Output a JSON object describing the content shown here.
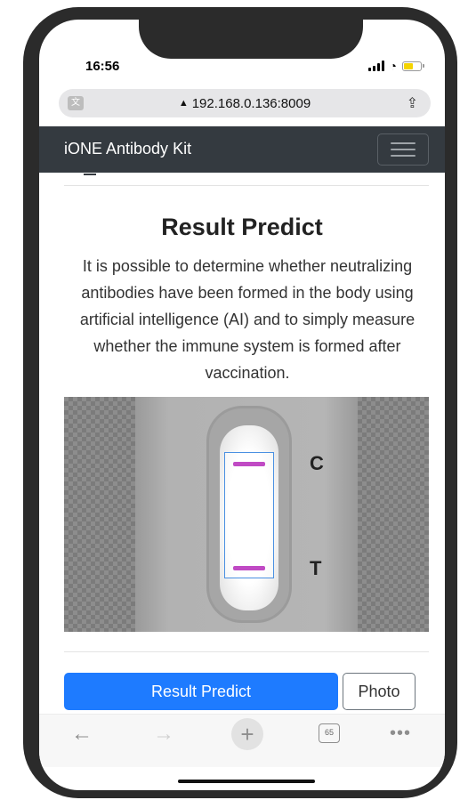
{
  "status_bar": {
    "time": "16:56"
  },
  "address_bar": {
    "url": "192.168.0.136:8009",
    "warning_glyph": "▲",
    "translate_glyph": "文"
  },
  "navbar": {
    "brand": "iONE Antibody Kit"
  },
  "content": {
    "title": "Result Predict",
    "description": "It is possible to determine whether neutralizing antibodies have been formed in the body using artificial intelligence (AI) and to simply measure whether the immune system is formed after vaccination."
  },
  "test_image": {
    "control_label": "C",
    "test_label": "T"
  },
  "actions": {
    "predict_label": "Result Predict",
    "photo_label": "Photo"
  },
  "toolbar": {
    "tab_count": "65"
  },
  "colors": {
    "navbar_bg": "#343a40",
    "primary_button": "#1e7bff",
    "line_color": "#c04ac4"
  }
}
